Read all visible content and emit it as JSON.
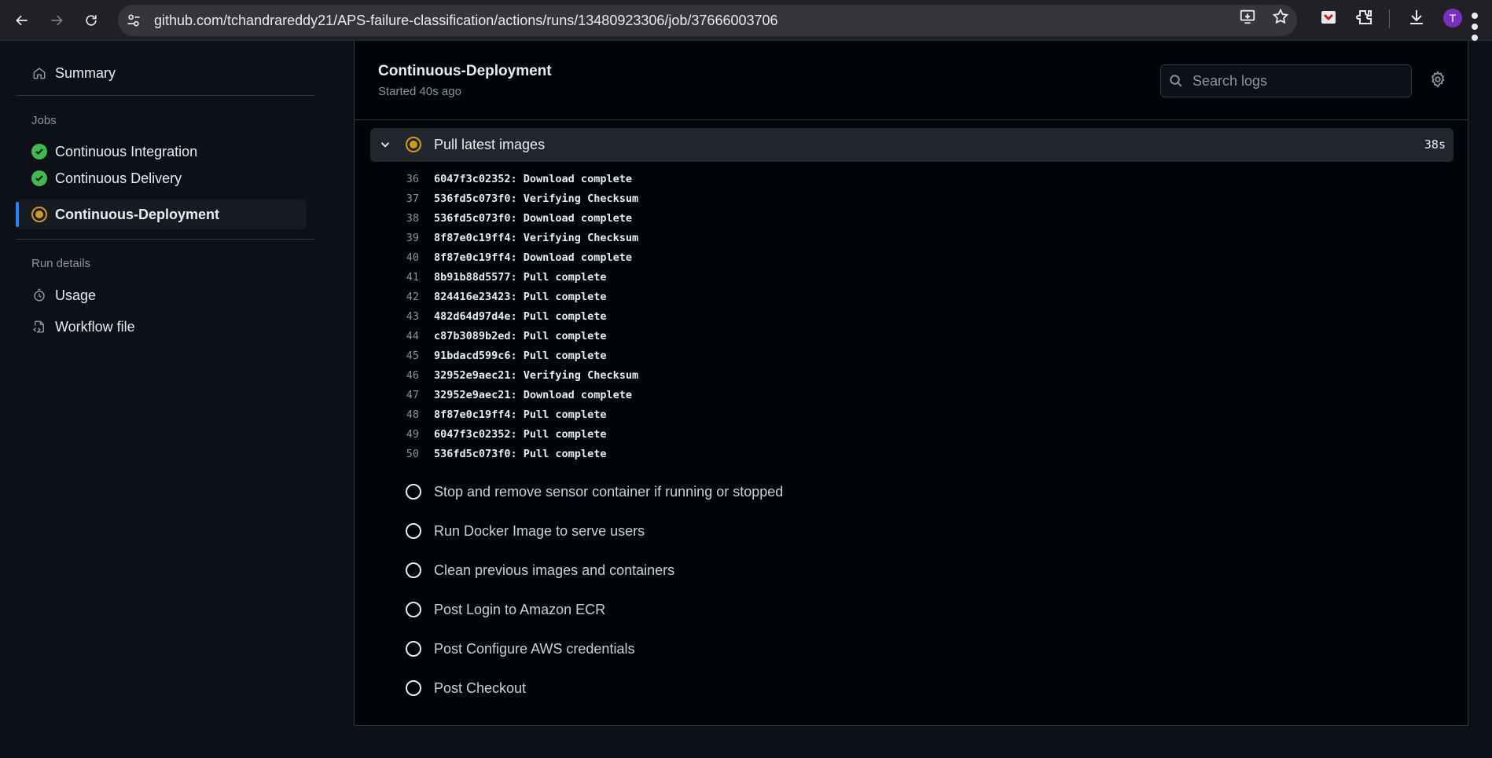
{
  "browser": {
    "url": "github.com/tchandrareddy21/APS-failure-classification/actions/runs/13480923306/job/37666003706",
    "profile_initial": "T",
    "icons": [
      "back-icon",
      "forward-icon",
      "reload-icon",
      "site-settings-icon",
      "install-app-icon",
      "bookmark-star-icon",
      "extension-pocket-icon",
      "extensions-puzzle-icon",
      "download-icon",
      "menu-kebab-icon"
    ]
  },
  "sidebar": {
    "summary_label": "Summary",
    "jobs_heading": "Jobs",
    "jobs": [
      {
        "label": "Continuous Integration",
        "status": "success"
      },
      {
        "label": "Continuous Delivery",
        "status": "success"
      },
      {
        "label": "Continuous-Deployment",
        "status": "in_progress",
        "active": true
      }
    ],
    "run_details_heading": "Run details",
    "usage_label": "Usage",
    "workflow_file_label": "Workflow file"
  },
  "job": {
    "title": "Continuous-Deployment",
    "subtitle": "Started 40s ago",
    "search_placeholder": "Search logs"
  },
  "current_step": {
    "name": "Pull latest images",
    "duration": "38s",
    "status": "in_progress",
    "logs": [
      {
        "n": "36",
        "text": "6047f3c02352: Download complete"
      },
      {
        "n": "37",
        "text": "536fd5c073f0: Verifying Checksum"
      },
      {
        "n": "38",
        "text": "536fd5c073f0: Download complete"
      },
      {
        "n": "39",
        "text": "8f87e0c19ff4: Verifying Checksum"
      },
      {
        "n": "40",
        "text": "8f87e0c19ff4: Download complete"
      },
      {
        "n": "41",
        "text": "8b91b88d5577: Pull complete"
      },
      {
        "n": "42",
        "text": "824416e23423: Pull complete"
      },
      {
        "n": "43",
        "text": "482d64d97d4e: Pull complete"
      },
      {
        "n": "44",
        "text": "c87b3089b2ed: Pull complete"
      },
      {
        "n": "45",
        "text": "91bdacd599c6: Pull complete"
      },
      {
        "n": "46",
        "text": "32952e9aec21: Verifying Checksum"
      },
      {
        "n": "47",
        "text": "32952e9aec21: Download complete"
      },
      {
        "n": "48",
        "text": "8f87e0c19ff4: Pull complete"
      },
      {
        "n": "49",
        "text": "6047f3c02352: Pull complete"
      },
      {
        "n": "50",
        "text": "536fd5c073f0: Pull complete"
      }
    ]
  },
  "pending_steps": [
    "Stop and remove sensor container if running or stopped",
    "Run Docker Image to serve users",
    "Clean previous images and containers",
    "Post Login to Amazon ECR",
    "Post Configure AWS credentials",
    "Post Checkout"
  ],
  "colors": {
    "success": "#3fb950",
    "in_progress": "#d29922",
    "accent": "#2f81f7",
    "background": "#0d1117"
  }
}
